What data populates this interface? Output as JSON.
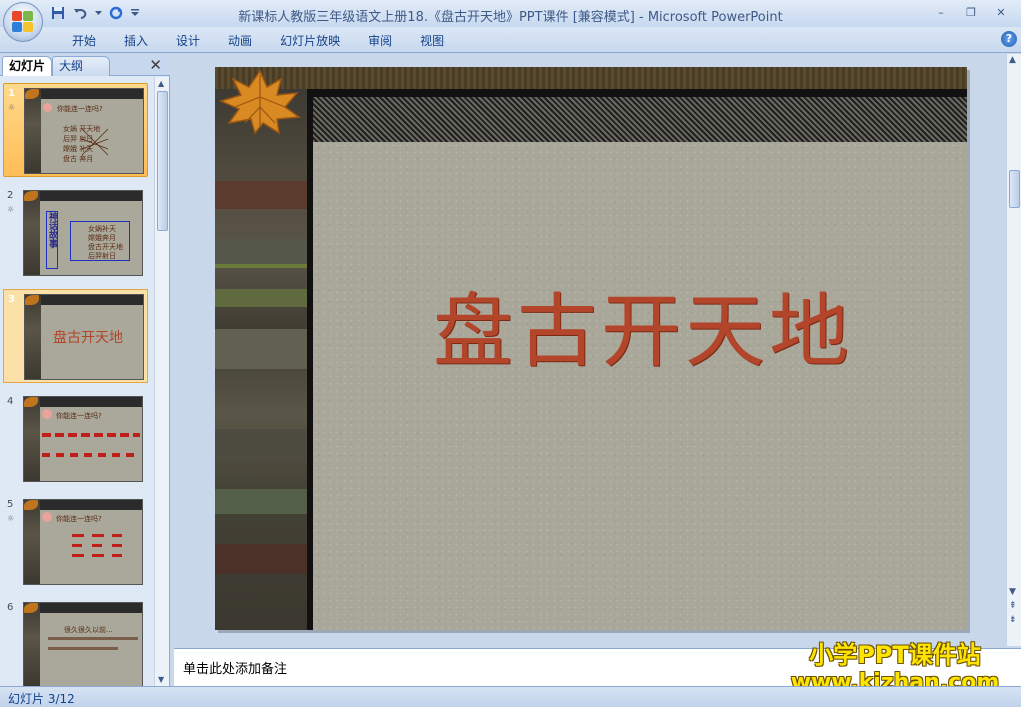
{
  "window": {
    "title": "新课标人教版三年级语文上册18.《盘古开天地》PPT课件 [兼容模式] - Microsoft PowerPoint",
    "minimize": "–",
    "restore": "❐",
    "close": "✕"
  },
  "ribbon": {
    "tabs": [
      "开始",
      "插入",
      "设计",
      "动画",
      "幻灯片放映",
      "审阅",
      "视图"
    ],
    "help": "?"
  },
  "panel": {
    "tab_slides": "幻灯片",
    "tab_outline": "大纲",
    "close": "✕"
  },
  "thumbnails": [
    {
      "num": "1",
      "anim": "☼",
      "lines": [
        "你能连一连吗?",
        "女娲    开天地",
        "后羿    射日",
        "嫦娥    补天",
        "盘古    奔月"
      ]
    },
    {
      "num": "2",
      "anim": "☼",
      "lines": [
        "神话故事",
        "女娲补天",
        "嫦娥奔月",
        "盘古开天地",
        "后羿射日"
      ]
    },
    {
      "num": "3",
      "anim": "",
      "lines": [
        "盘古开天地"
      ]
    },
    {
      "num": "4",
      "anim": "",
      "lines": [
        "你能连一连吗?"
      ]
    },
    {
      "num": "5",
      "anim": "☼",
      "lines": [
        "你能连一连吗?"
      ]
    },
    {
      "num": "6",
      "anim": "",
      "lines": [
        "很久很久以前..."
      ]
    }
  ],
  "slide": {
    "title": "盘古开天地"
  },
  "notes": {
    "placeholder": "单击此处添加备注"
  },
  "watermark": {
    "line1": "小学PPT课件站",
    "line2": "www.kjzhan.com"
  },
  "status": {
    "slide_indicator": "幻灯片 3/12"
  },
  "colors": {
    "title_text": "#b2452a",
    "selection": "#ffbd57",
    "watermark": "#ffe400"
  }
}
